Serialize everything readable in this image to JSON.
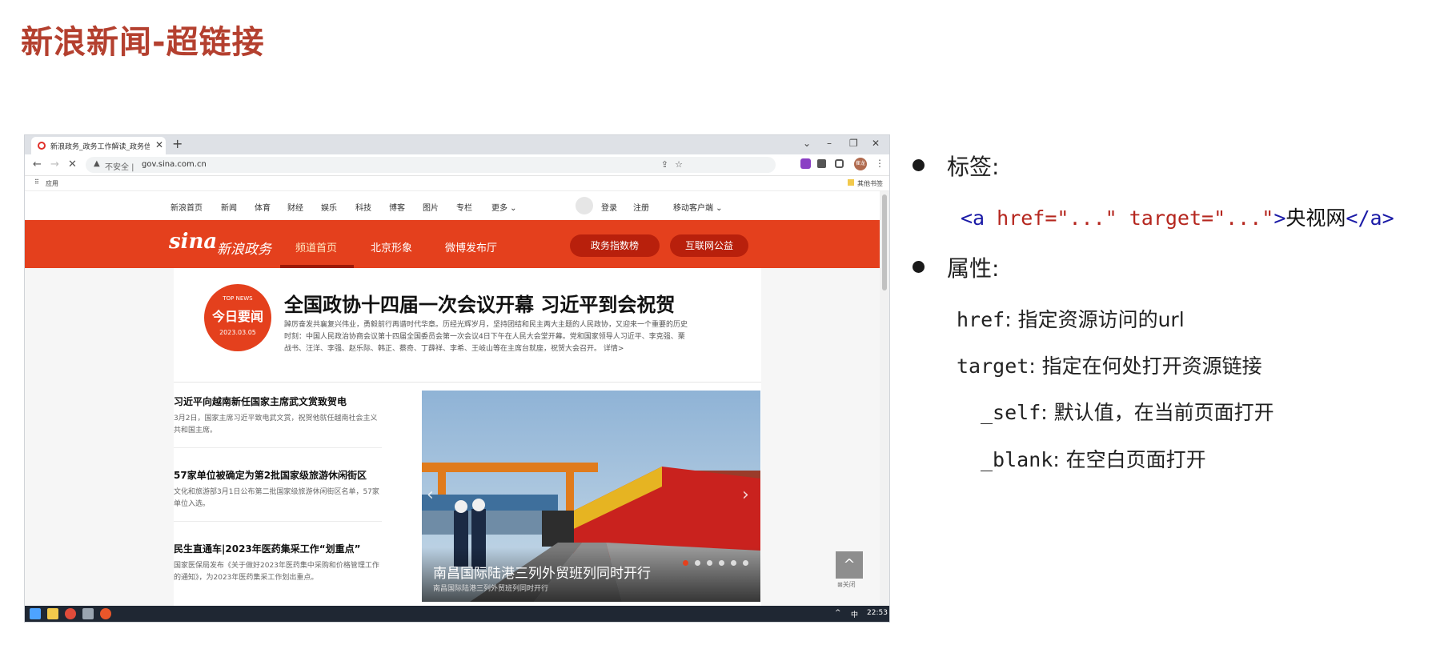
{
  "slide": {
    "title": "新浪新闻-超链接"
  },
  "browser": {
    "tab_title": "新浪政务_政务工作解读_政务信",
    "tab_close": "✕",
    "new_tab": "+",
    "url_security": "不安全",
    "url_host": "gov.sina.com.cn",
    "bookmark_apps": "应用",
    "bookmark_other": "其他书签",
    "profile_label": "崔龙"
  },
  "site": {
    "topnav": [
      "新浪首页",
      "新闻",
      "体育",
      "财经",
      "娱乐",
      "科技",
      "博客",
      "图片",
      "专栏",
      "更多 ⌄"
    ],
    "login": "登录",
    "register": "注册",
    "mobile": "移动客户端 ⌄",
    "logo_sina": "sina",
    "logo_name": "新浪政务",
    "rednav": [
      "频道首页",
      "北京形象",
      "微博发布厅"
    ],
    "pill_index": "政务指数榜",
    "pill_public": "互联网公益",
    "badge_top": "TOP NEWS",
    "badge_main": "今日要闻",
    "badge_date": "2023.03.05",
    "headline": "全国政协十四届一次会议开幕 习近平到会祝贺",
    "lead": "踔厉奋发共襄复兴伟业，勇毅前行再谱时代华章。历经光辉岁月，坚持团结和民主两大主题的人民政协，又迎来一个重要的历史时刻：中国人民政治协商会议第十四届全国委员会第一次会议4日下午在人民大会堂开幕。党和国家领导人习近平、李克强、栗战书、汪洋、李强、赵乐际、韩正、蔡奇、丁薛祥、李希、王岐山等在主席台就座，祝贺大会召开。 详情>",
    "news": [
      {
        "title": "习近平向越南新任国家主席武文赏致贺电",
        "desc": "3月2日，国家主席习近平致电武文赏，祝贺他就任越南社会主义共和国主席。"
      },
      {
        "title": "57家单位被确定为第2批国家级旅游休闲街区",
        "desc": "文化和旅游部3月1日公布第二批国家级旅游休闲街区名单，57家单位入选。"
      },
      {
        "title": "民生直通车|2023年医药集采工作“划重点”",
        "desc": "国家医保局发布《关于做好2023年医药集中采购和价格管理工作的通知》，为2023年医药集采工作划出重点。"
      }
    ],
    "photo_caption": "南昌国际陆港三列外贸班列同时开行",
    "photo_subcaption": "南昌国际陆港三列外贸班列同时开行",
    "back_top": "^",
    "close_ad": "关闭"
  },
  "taskbar": {
    "ime": "中",
    "clock": "22:53"
  },
  "notes": {
    "label_heading": "标签:",
    "code_open": "<a ",
    "code_href": "href=\"...\"",
    "code_target": " target=\"...\"",
    "code_close": ">",
    "code_text": "央视网",
    "code_end": "</a>",
    "attr_heading": "属性:",
    "href_key": "href",
    "href_desc": ": 指定资源访问的url",
    "target_key": "target",
    "target_desc": ": 指定在何处打开资源链接",
    "self_key": "_self",
    "self_desc": ": 默认值，在当前页面打开",
    "blank_key": "_blank",
    "blank_desc": ": 在空白页面打开"
  },
  "colors": {
    "sina_red": "#e4401d",
    "title_red": "#b4402f",
    "code_blue": "#1a1aa6",
    "code_red": "#b5261e"
  }
}
